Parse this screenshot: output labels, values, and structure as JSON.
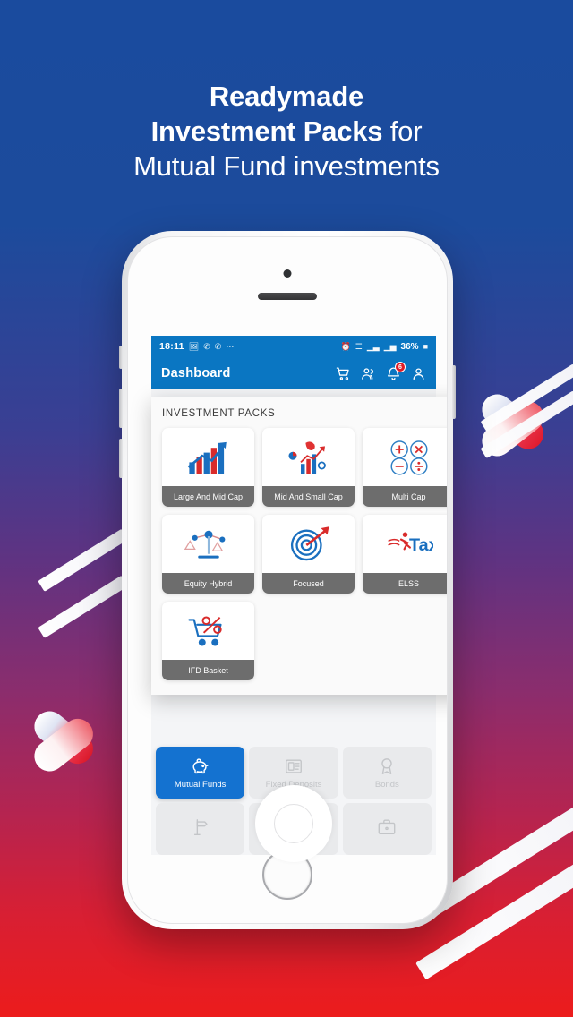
{
  "theme": {
    "bg_gradient_top": "#1a4b9e",
    "bg_gradient_mid": "#7b2f78",
    "bg_gradient_bottom": "#ec1c1c",
    "app_blue": "#0a76c2",
    "tile_active_blue": "#1472d0",
    "label_gray": "#6d6d6d",
    "accent_red": "#e01b24"
  },
  "headline": {
    "line1_bold": "Readymade",
    "line2_bold": "Investment Packs",
    "line2_rest": " for",
    "line3": "Mutual Fund investments"
  },
  "phone": {
    "status_bar": {
      "time": "18:11",
      "icons": [
        "photo-icon",
        "whatsapp-icon",
        "whatsapp-icon",
        "more-dots-icon"
      ],
      "right_icons": [
        "alarm-icon",
        "wifi-icon",
        "signal-dual-icon",
        "signal-icon"
      ],
      "battery": "36%"
    },
    "app_bar": {
      "title": "Dashboard",
      "icons": [
        {
          "name": "cart-icon",
          "badge": null
        },
        {
          "name": "people-icon",
          "badge": null
        },
        {
          "name": "bell-icon",
          "badge": "6"
        },
        {
          "name": "profile-icon",
          "badge": null
        }
      ]
    },
    "packs_panel": {
      "title": "INVESTMENT PACKS",
      "packs": [
        {
          "label": "Large And Mid Cap",
          "icon": "growth-bars-icon"
        },
        {
          "label": "Mid And Small Cap",
          "icon": "analytics-chart-icon"
        },
        {
          "label": "Multi Cap",
          "icon": "calculator-ops-icon"
        },
        {
          "label": "Equity Hybrid",
          "icon": "balance-scale-icon"
        },
        {
          "label": "Focused",
          "icon": "target-dart-icon"
        },
        {
          "label": "ELSS",
          "icon": "tax-icon"
        },
        {
          "label": "IFD Basket",
          "icon": "cart-percent-icon"
        }
      ]
    },
    "bottom_tiles": [
      {
        "label": "Mutual Funds",
        "icon": "piggy-bank-icon",
        "active": true
      },
      {
        "label": "Fixed Deposits",
        "icon": "deposit-box-icon",
        "active": false
      },
      {
        "label": "Bonds",
        "icon": "bond-ribbon-icon",
        "active": false
      },
      {
        "label": "",
        "icon": "signpost-icon",
        "active": false
      },
      {
        "label": "",
        "icon": "center-hidden-icon",
        "active": false
      },
      {
        "label": "",
        "icon": "briefcase-icon",
        "active": false
      }
    ]
  }
}
